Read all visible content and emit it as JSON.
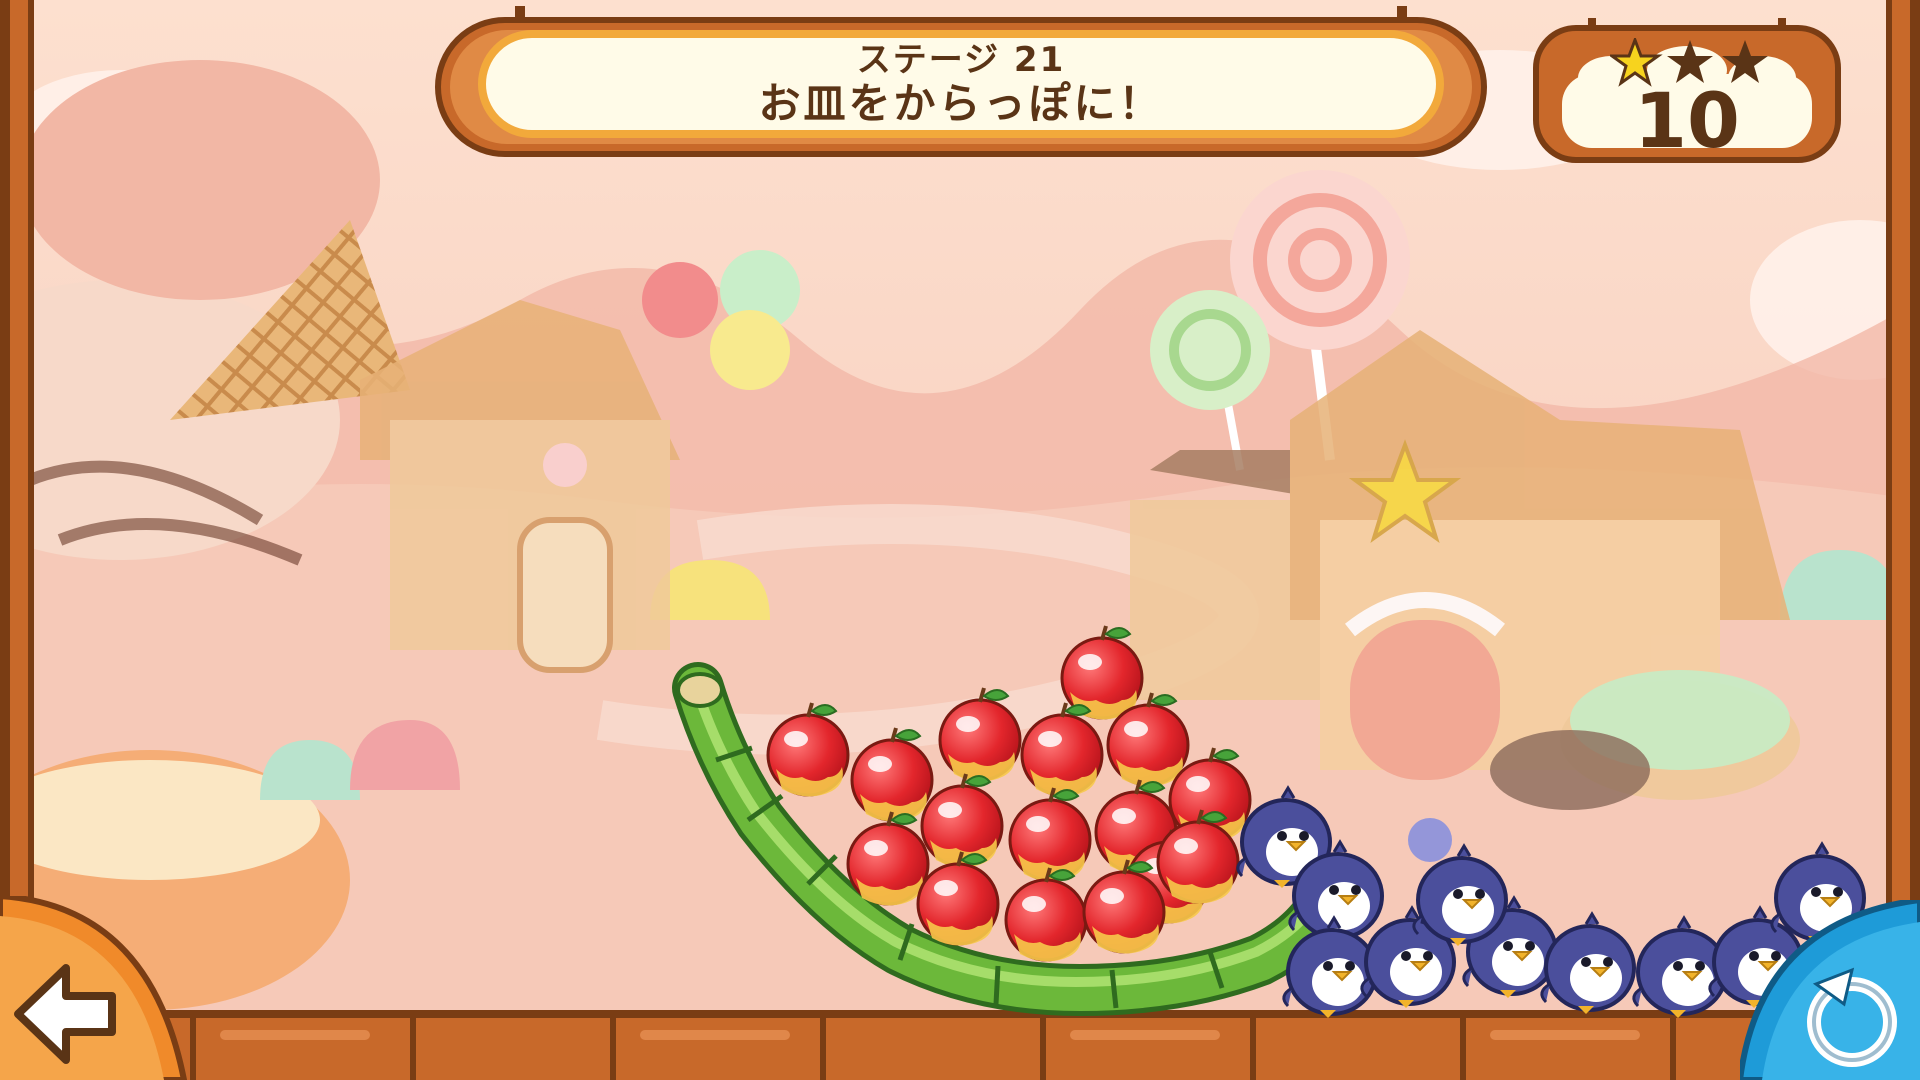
{
  "hud": {
    "stage_label": "ステージ 21",
    "objective": "お皿をからっぽに！",
    "score": "10",
    "stars_earned": 1,
    "stars_total": 3
  },
  "controls": {
    "back_icon": "back-arrow-icon",
    "retry_icon": "retry-icon"
  },
  "colors": {
    "wood": "#c8692a",
    "wood_dark": "#7a3d14",
    "plaque_fill": "#fffbe8",
    "plaque_border": "#f2a93b",
    "text": "#5a3416",
    "apple": "#e3262c",
    "bamboo": "#6cb83a",
    "penguin": "#4b4f9c",
    "star_gold": "#f7d31e",
    "star_empty": "#5a3416"
  },
  "scene": {
    "apples_count": 16,
    "penguins_count": 10
  }
}
